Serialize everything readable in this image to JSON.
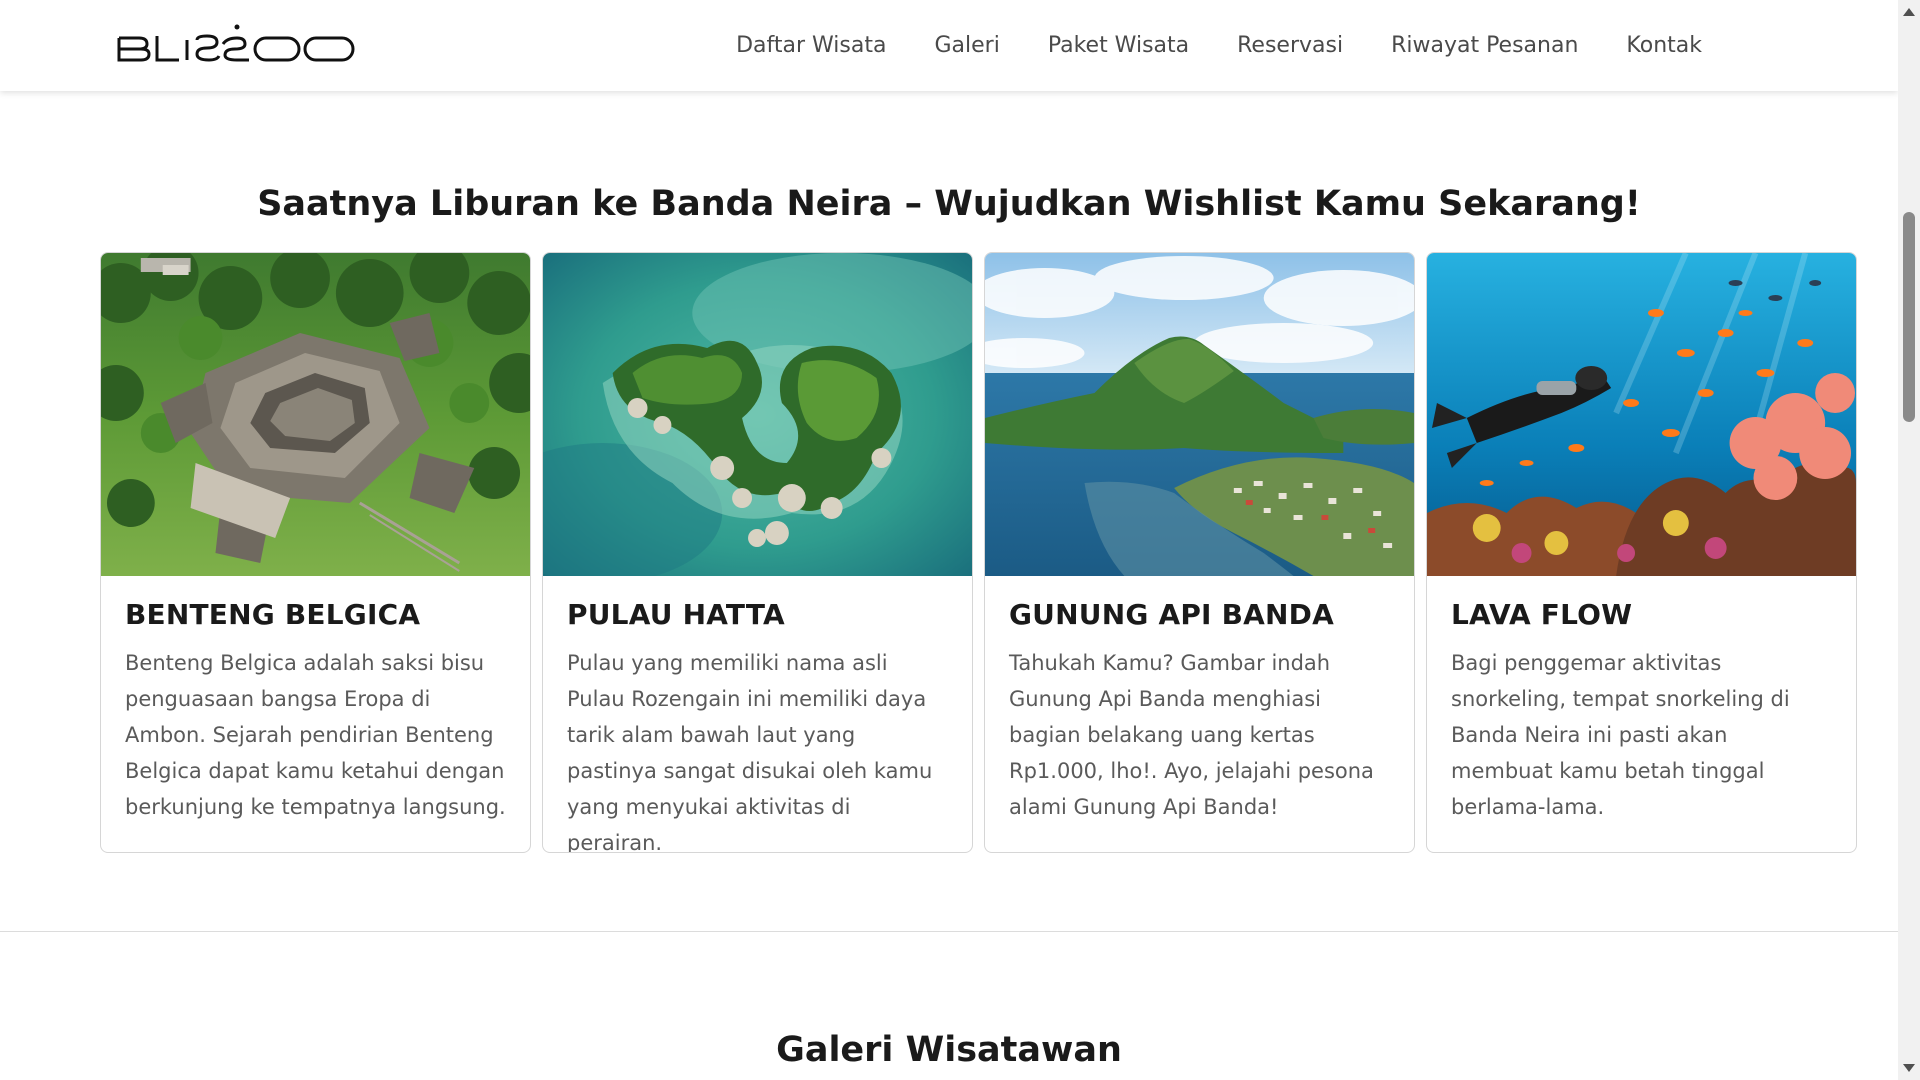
{
  "header": {
    "logo_text": "BLISSOO",
    "nav": [
      "Daftar Wisata",
      "Galeri",
      "Paket Wisata",
      "Reservasi",
      "Riwayat Pesanan",
      "Kontak"
    ]
  },
  "main": {
    "section_title": "Saatnya Liburan ke Banda Neira – Wujudkan Wishlist Kamu Sekarang!",
    "cards": [
      {
        "title": "BENTENG BELGICA",
        "text": "Benteng Belgica adalah saksi bisu penguasaan bangsa Eropa di Ambon. Sejarah pendirian Benteng Belgica dapat kamu ketahui dengan berkunjung ke tempatnya langsung.",
        "image": "fort-aerial-photo"
      },
      {
        "title": "PULAU HATTA",
        "text": "Pulau yang memiliki nama asli Pulau Rozengain ini memiliki daya tarik alam bawah laut yang pastinya sangat disukai oleh kamu yang menyukai aktivitas di perairan.",
        "image": "island-aerial-photo"
      },
      {
        "title": "GUNUNG API BANDA",
        "text": "Tahukah Kamu? Gambar indah Gunung Api Banda menghiasi bagian belakang uang kertas Rp1.000, lho!. Ayo, jelajahi pesona alami Gunung Api Banda!",
        "image": "volcano-island-photo"
      },
      {
        "title": "LAVA FLOW",
        "text": "Bagi penggemar aktivitas snorkeling, tempat snorkeling di Banda Neira ini pasti akan membuat kamu betah tinggal berlama-lama.",
        "image": "coral-reef-diver-photo"
      }
    ],
    "gallery_title": "Galeri Wisatawan"
  },
  "colors": {
    "nav_text": "#4a4a4a",
    "heading": "#1a1a1a",
    "body_text": "#5a5a5a",
    "border": "#d6d6d6"
  }
}
